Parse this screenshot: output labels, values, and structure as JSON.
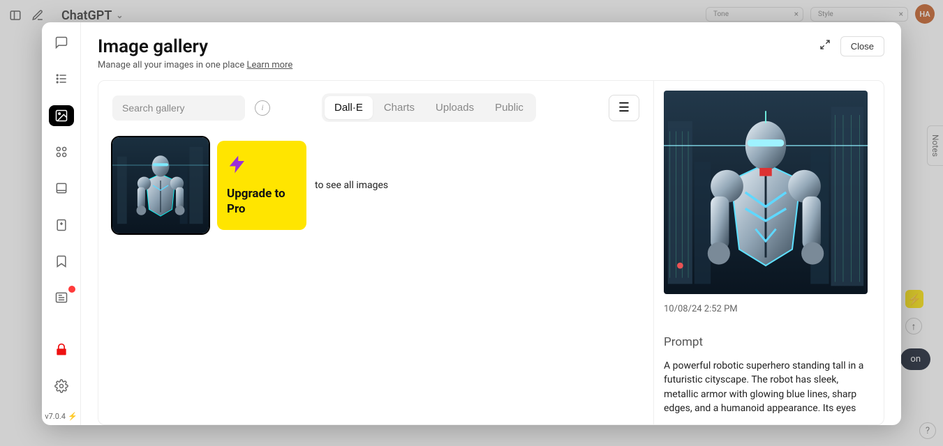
{
  "bg": {
    "title": "ChatGPT",
    "tone_label": "Tone",
    "style_label": "Style",
    "avatar": "HA",
    "notes": "Notes",
    "on_label": "on",
    "help": "?"
  },
  "modal": {
    "title": "Image gallery",
    "subtitle": "Manage all your images in one place ",
    "learn_more": "Learn more",
    "close": "Close",
    "search_placeholder": "Search gallery",
    "tabs": [
      "Dall·E",
      "Charts",
      "Uploads",
      "Public"
    ],
    "upgrade": "Upgrade to Pro",
    "upgrade_after": "to see all images",
    "version": "v7.0.4"
  },
  "detail": {
    "timestamp": "10/08/24 2:52 PM",
    "prompt_heading": "Prompt",
    "prompt_text": "A powerful robotic superhero standing tall in a futuristic cityscape. The robot has sleek, metallic armor with glowing blue lines, sharp edges, and a humanoid appearance. Its eyes"
  }
}
